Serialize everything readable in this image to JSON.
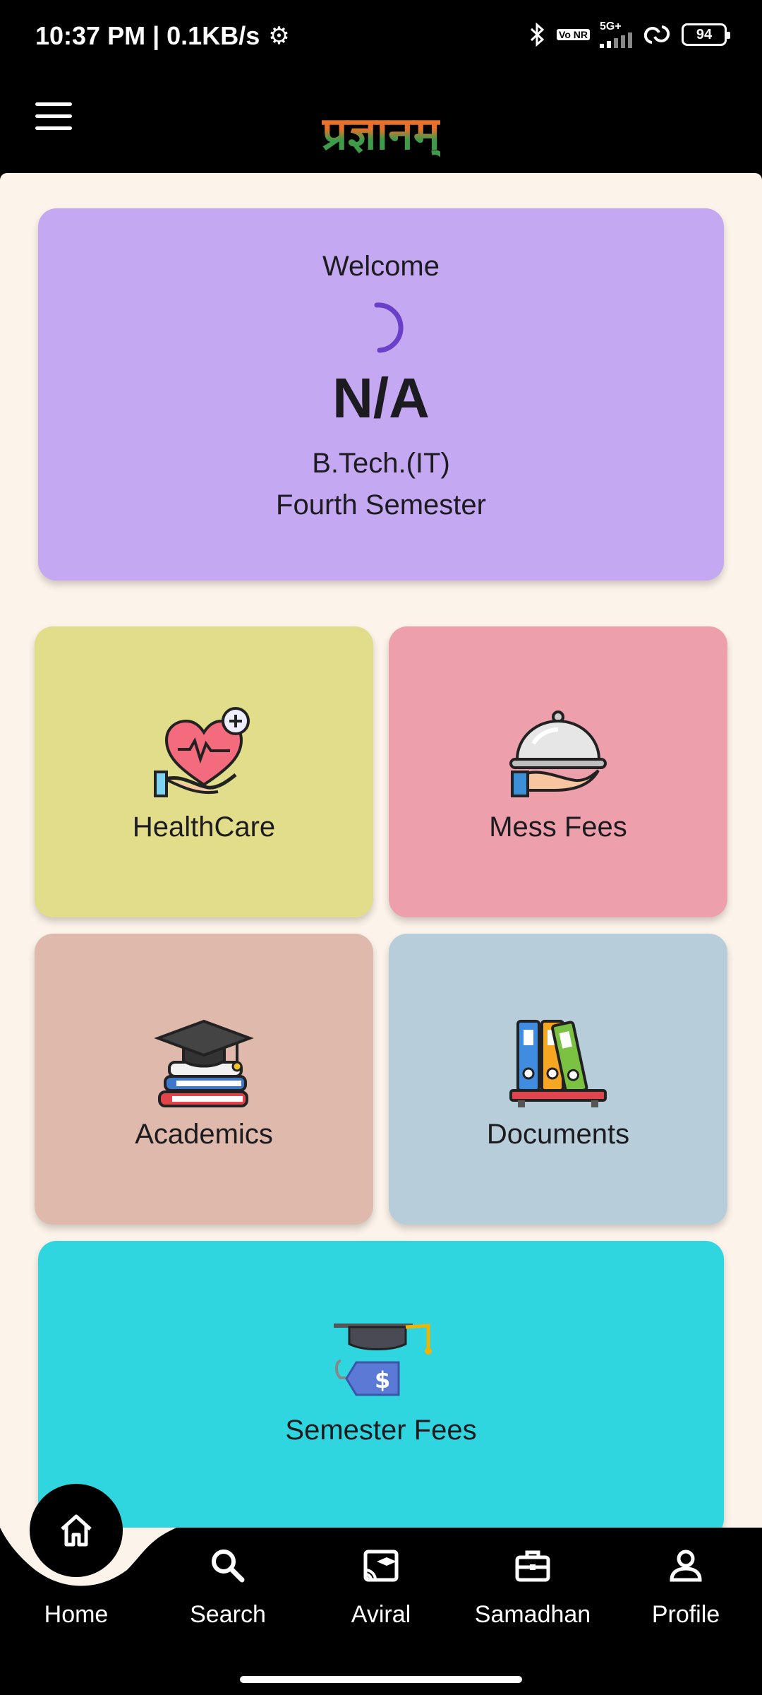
{
  "status_bar": {
    "time_speed": "10:37 PM | 0.1KB/s",
    "network": "5G+",
    "volte": "Vo NR",
    "battery": "94"
  },
  "app_bar": {
    "logo_text": "प्रज्ञानम्"
  },
  "welcome_card": {
    "greeting": "Welcome",
    "name": "N/A",
    "course": "B.Tech.(IT)",
    "semester": "Fourth Semester"
  },
  "tiles": {
    "healthcare": "HealthCare",
    "mess_fees": "Mess Fees",
    "academics": "Academics",
    "documents": "Documents",
    "semester_fees": "Semester Fees"
  },
  "bottom_nav": {
    "home": "Home",
    "search": "Search",
    "aviral": "Aviral",
    "samadhan": "Samadhan",
    "profile": "Profile"
  },
  "colors": {
    "welcome": "#c5a8f2",
    "healthcare": "#e2dd8b",
    "mess_fees": "#eda0ac",
    "academics": "#dfb9ab",
    "documents": "#b7cdd9",
    "semester_fees": "#2fd6e0",
    "background": "#fcf3ea"
  }
}
